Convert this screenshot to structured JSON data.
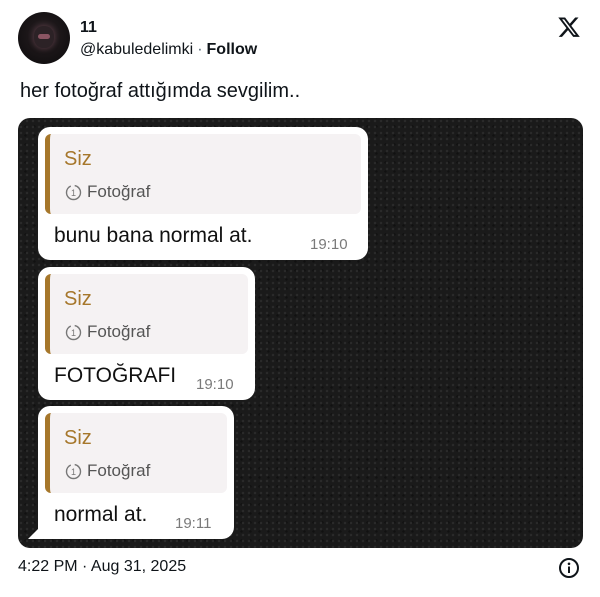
{
  "tweet": {
    "display_name": "11",
    "handle": "@kabuledelimki",
    "separator": "·",
    "follow_label": "Follow",
    "text": "her fotoğraf attığımda sevgilim..",
    "timestamp": "4:22 PM · Aug 31, 2025"
  },
  "icons": {
    "platform_logo": "x-logo-icon",
    "info": "info-icon",
    "view_once": "view-once-icon"
  },
  "chat": {
    "messages": [
      {
        "quote_author": "Siz",
        "quote_media": "Fotoğraf",
        "text": "bunu bana normal at.",
        "time": "19:10"
      },
      {
        "quote_author": "Siz",
        "quote_media": "Fotoğraf",
        "text": "FOTOĞRAFI",
        "time": "19:10"
      },
      {
        "quote_author": "Siz",
        "quote_media": "Fotoğraf",
        "text": "normal at.",
        "time": "19:11"
      }
    ]
  },
  "colors": {
    "quote_accent": "#a6772b",
    "media_background": "#1a1a1a",
    "bubble": "#ffffff"
  }
}
